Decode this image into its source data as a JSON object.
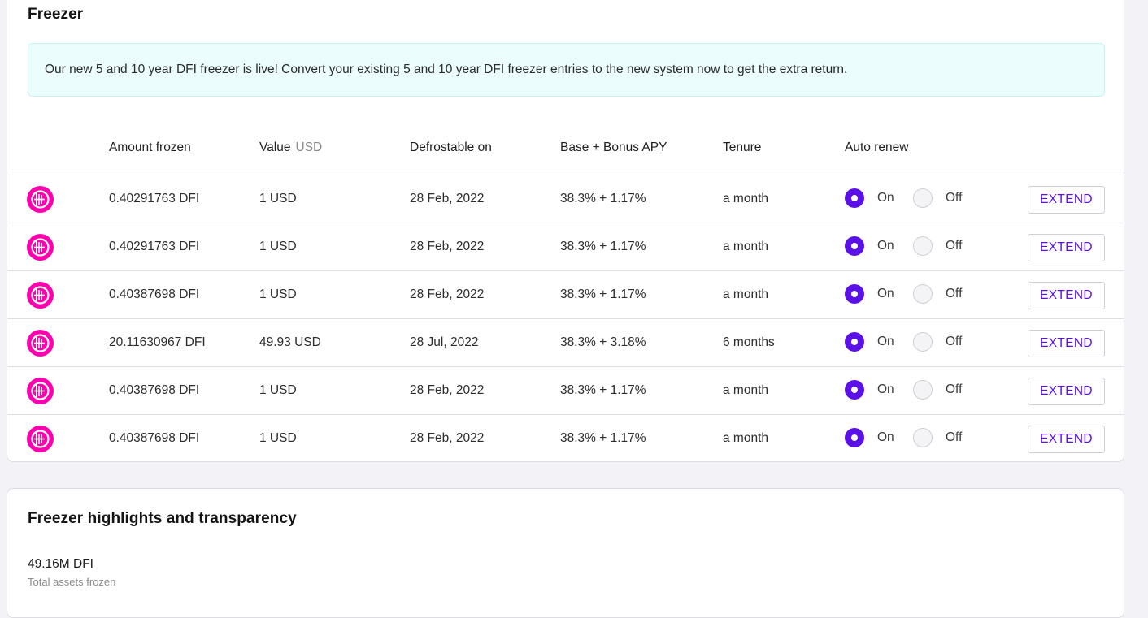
{
  "freezer": {
    "title": "Freezer",
    "banner": "Our new 5 and 10 year DFI freezer is live! Convert your existing 5 and 10 year DFI freezer entries to the new system now to get the extra return.",
    "columns": {
      "amount": "Amount frozen",
      "value": "Value",
      "value_unit": "USD",
      "date": "Defrostable on",
      "apy": "Base + Bonus APY",
      "tenure": "Tenure",
      "auto_renew": "Auto renew"
    },
    "rows": [
      {
        "amount": "0.40291763 DFI",
        "value": "1 USD",
        "date": "28 Feb, 2022",
        "apy": "38.3% + 1.17%",
        "tenure": "a month",
        "on": "On",
        "off": "Off",
        "auto_renew": "on",
        "action": "EXTEND"
      },
      {
        "amount": "0.40291763 DFI",
        "value": "1 USD",
        "date": "28 Feb, 2022",
        "apy": "38.3% + 1.17%",
        "tenure": "a month",
        "on": "On",
        "off": "Off",
        "auto_renew": "on",
        "action": "EXTEND"
      },
      {
        "amount": "0.40387698 DFI",
        "value": "1 USD",
        "date": "28 Feb, 2022",
        "apy": "38.3% + 1.17%",
        "tenure": "a month",
        "on": "On",
        "off": "Off",
        "auto_renew": "on",
        "action": "EXTEND"
      },
      {
        "amount": "20.11630967 DFI",
        "value": "49.93 USD",
        "date": "28 Jul, 2022",
        "apy": "38.3% + 3.18%",
        "tenure": "6 months",
        "on": "On",
        "off": "Off",
        "auto_renew": "on",
        "action": "EXTEND"
      },
      {
        "amount": "0.40387698 DFI",
        "value": "1 USD",
        "date": "28 Feb, 2022",
        "apy": "38.3% + 1.17%",
        "tenure": "a month",
        "on": "On",
        "off": "Off",
        "auto_renew": "on",
        "action": "EXTEND"
      },
      {
        "amount": "0.40387698 DFI",
        "value": "1 USD",
        "date": "28 Feb, 2022",
        "apy": "38.3% + 1.17%",
        "tenure": "a month",
        "on": "On",
        "off": "Off",
        "auto_renew": "on",
        "action": "EXTEND"
      }
    ],
    "icon": "dfi-coin-icon",
    "colors": {
      "accent": "#5b10e8",
      "dfi_pink": "#ff00af",
      "banner_bg": "#ecfdfd"
    }
  },
  "highlights": {
    "title": "Freezer highlights and transparency",
    "total_value": "49.16M DFI",
    "total_label": "Total assets frozen"
  }
}
